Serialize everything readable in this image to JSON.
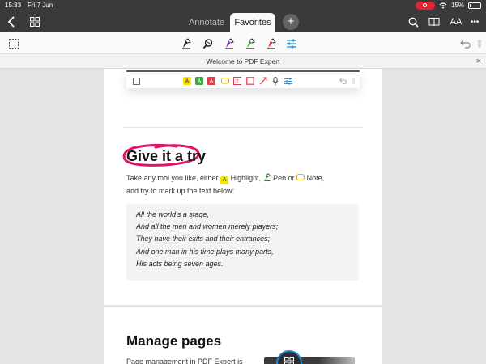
{
  "status_bar": {
    "time": "15:33",
    "date": "Fri 7 Jun",
    "battery": "15%"
  },
  "nav": {
    "tabs": [
      {
        "label": "Annotate",
        "active": false
      },
      {
        "label": "Favorites",
        "active": true
      }
    ],
    "add_label": "+",
    "reader_label": "AA",
    "more_label": "•••"
  },
  "toolbar": {
    "tools": [
      "select-icon",
      "pen-icon",
      "magnifier-icon",
      "pen-purple-icon",
      "pen-green-icon",
      "pen-red-icon",
      "tool-settings-icon"
    ],
    "colors": {
      "black": "#1c1c1e",
      "purple": "#8e3bd6",
      "green": "#3aa83a",
      "red": "#e33b4a",
      "blue": "#2b98e0"
    }
  },
  "banner": {
    "title": "Welcome to PDF Expert",
    "close": "×"
  },
  "page": {
    "heading": "Give it a try",
    "intro_part1": "Take any tool you like, either ",
    "highlight_letter": "A",
    "highlight_label": " Highlight, ",
    "pen_label": " Pen or ",
    "note_label": " Note,",
    "intro_line2": "and try to mark up the text below:",
    "quote_lines": [
      " All the world’s a stage,",
      "And all the men and women merely players;",
      "They have their exits and their entrances;",
      "And one man in his time plays many parts,",
      "His acts being seven ages."
    ],
    "manage_heading": "Manage pages",
    "manage_text": "Page management in PDF Expert is"
  },
  "accent_color": "#e0136b"
}
